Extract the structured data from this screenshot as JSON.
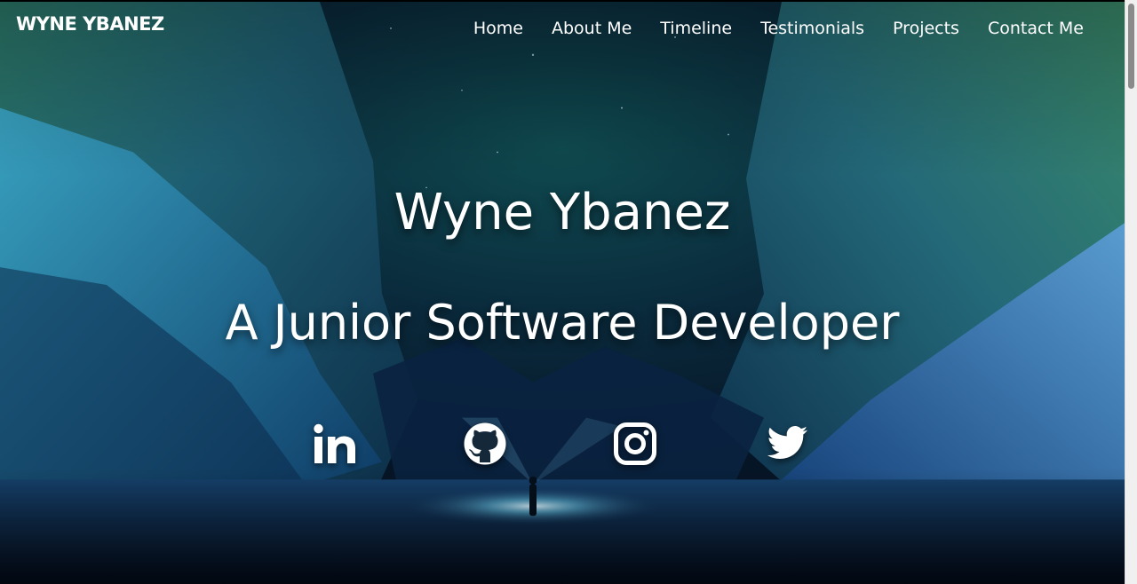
{
  "brand": "WYNE YBANEZ",
  "nav": {
    "items": [
      {
        "label": "Home"
      },
      {
        "label": "About Me"
      },
      {
        "label": "Timeline"
      },
      {
        "label": "Testimonials"
      },
      {
        "label": "Projects"
      },
      {
        "label": "Contact Me"
      }
    ]
  },
  "hero": {
    "title": "Wyne Ybanez",
    "subtitle": "A Junior Software Developer"
  },
  "social": [
    "linkedin-icon",
    "github-icon",
    "instagram-icon",
    "twitter-icon"
  ],
  "colors": {
    "text": "#ffffff",
    "sky": "#0b2a3a",
    "rock": "#1f6f7a"
  }
}
